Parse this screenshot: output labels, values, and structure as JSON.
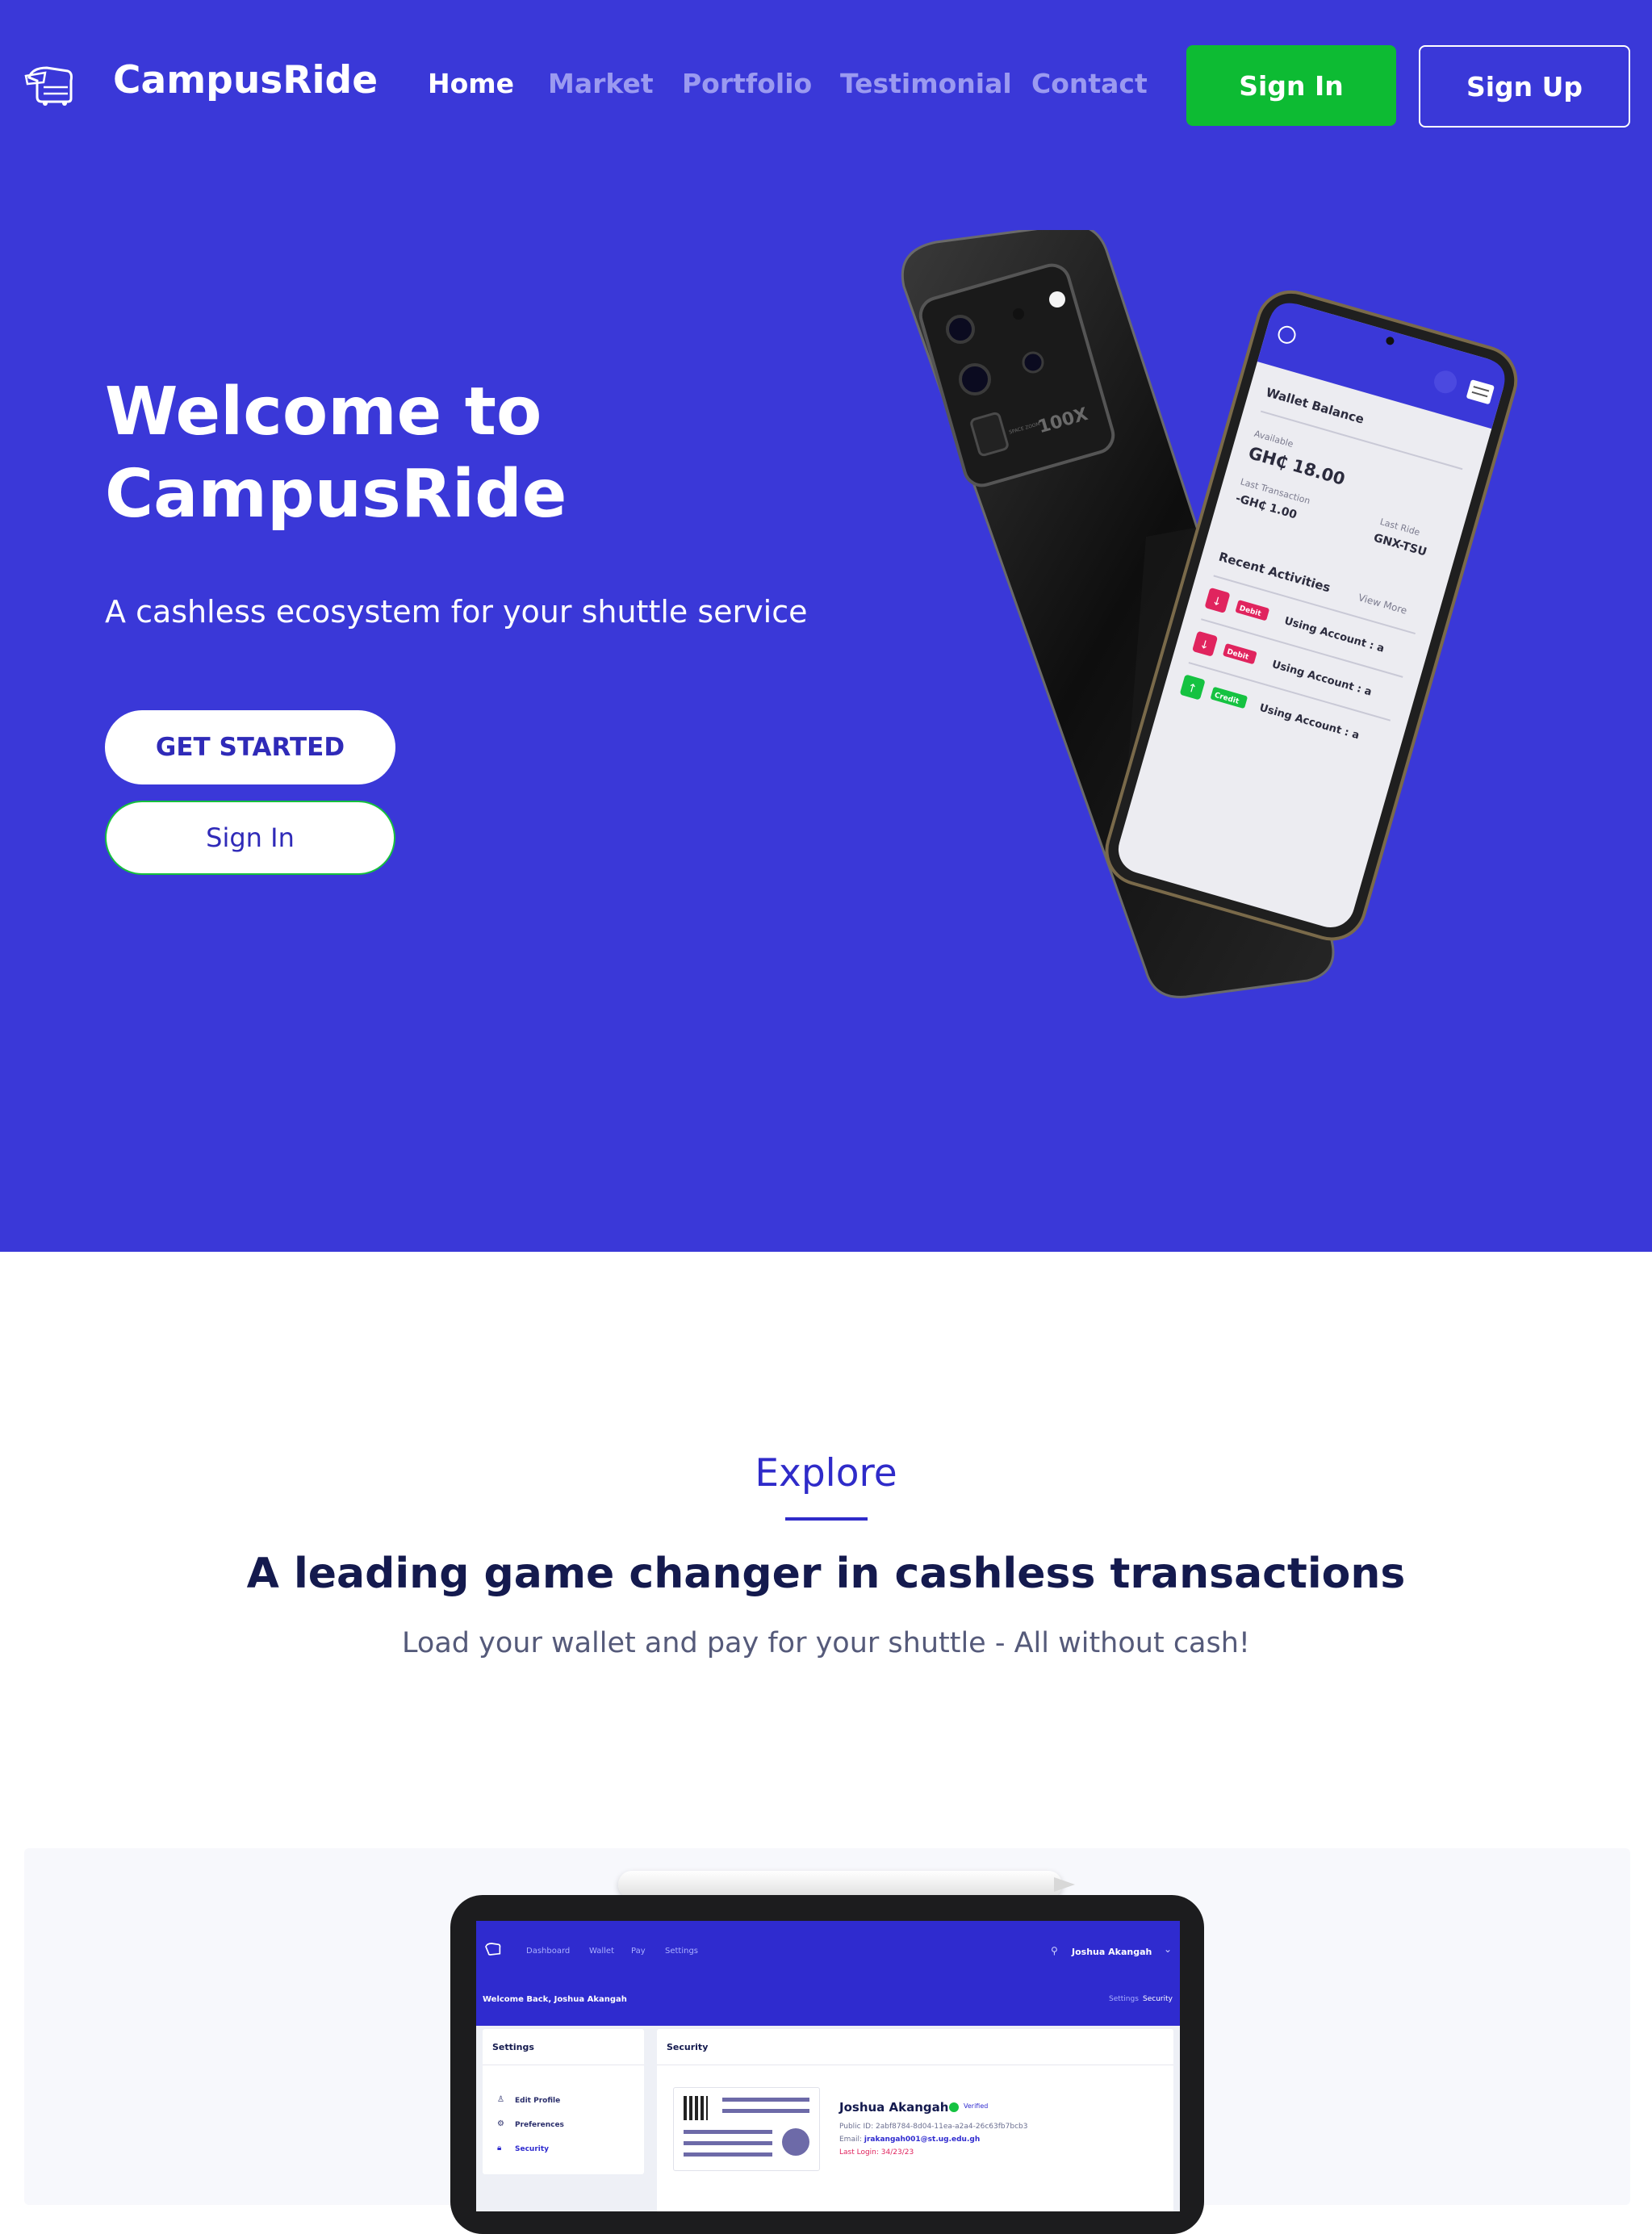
{
  "colors": {
    "brand_blue": "#3a38d8",
    "accent_green": "#0dbb33",
    "heading_navy": "#141a4e",
    "debit_red": "#e0245e",
    "credit_green": "#15c241"
  },
  "nav": {
    "brand": "CampusRide",
    "logo_icon": "shuttle-bus-icon",
    "links": [
      "Home",
      "Market",
      "Portfolio",
      "Testimonial",
      "Contact"
    ],
    "active_link": "Home",
    "sign_in": "Sign In",
    "sign_up": "Sign Up"
  },
  "hero": {
    "title_line1": "Welcome to",
    "title_line2": "CampusRide",
    "subtitle": "A cashless ecosystem for your shuttle service",
    "get_started": "GET STARTED",
    "sign_in": "Sign In"
  },
  "phone": {
    "camera_label": "100X",
    "camera_small_text": "SPACE ZOOM",
    "wallet_title": "Wallet Balance",
    "available_label": "Available",
    "available_value": "GH₵ 18.00",
    "last_transaction_label": "Last Transaction",
    "last_transaction_value": "-GH₵ 1.00",
    "last_ride_label": "Last Ride",
    "last_ride_value": "GNX-TSU",
    "recent_title": "Recent Activities",
    "view_more": "View More",
    "activities": [
      {
        "type": "Debit",
        "text": "Using Account : a"
      },
      {
        "type": "Debit",
        "text": "Using Account : a"
      },
      {
        "type": "Credit",
        "text": "Using Account : a"
      }
    ]
  },
  "explore": {
    "label": "Explore",
    "heading": "A leading game changer in cashless transactions",
    "subheading": "Load your wallet and pay for your shuttle - All without cash!"
  },
  "tablet": {
    "nav": [
      "Dashboard",
      "Wallet",
      "Pay",
      "Settings"
    ],
    "user_name": "Joshua Akangah",
    "welcome": "Welcome Back,  Joshua Akangah",
    "breadcrumb_settings": "Settings",
    "breadcrumb_security": "Security",
    "settings_title": "Settings",
    "menu": [
      "Edit Profile",
      "Preferences",
      "Security"
    ],
    "security_title": "Security",
    "profile_name": "Joshua Akangah",
    "verified": "Verified",
    "public_id_label": "Public ID:",
    "public_id": "2abf8784-8d04-11ea-a2a4-26c63fb7bcb3",
    "email_label": "Email:",
    "email": "jrakangah001@st.ug.edu.gh",
    "last_login_label": "Last Login:",
    "last_login": "34/23/23"
  }
}
